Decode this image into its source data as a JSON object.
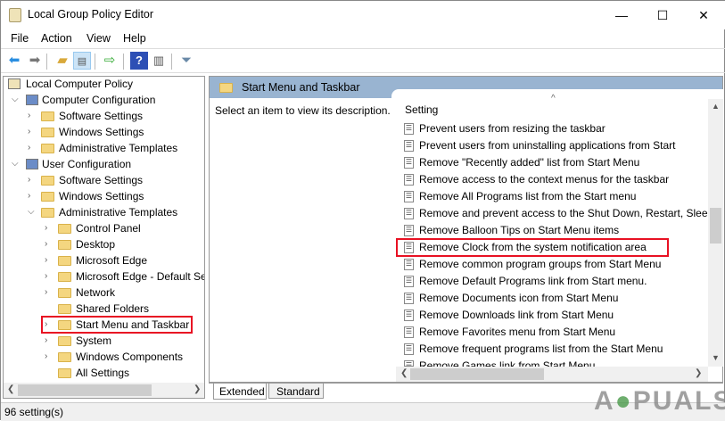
{
  "window": {
    "title": "Local Group Policy Editor",
    "minimize": "—",
    "maximize": "☐",
    "close": "✕"
  },
  "menu": [
    "File",
    "Action",
    "View",
    "Help"
  ],
  "toolbar": {
    "icons": [
      "back-icon",
      "forward-icon",
      "up-folder-icon",
      "show-hide-tree-icon",
      "export-list-icon",
      "help-icon",
      "show-action-pane-icon",
      "filter-icon"
    ]
  },
  "tree": [
    {
      "label": "Local Computer Policy",
      "level": 0
    },
    {
      "label": "Computer Configuration",
      "level": 1,
      "expanded": true
    },
    {
      "label": "Software Settings",
      "level": 2
    },
    {
      "label": "Windows Settings",
      "level": 2
    },
    {
      "label": "Administrative Templates",
      "level": 2
    },
    {
      "label": "User Configuration",
      "level": 1,
      "expanded": true
    },
    {
      "label": "Software Settings",
      "level": 2
    },
    {
      "label": "Windows Settings",
      "level": 2
    },
    {
      "label": "Administrative Templates",
      "level": 2,
      "expanded": true
    },
    {
      "label": "Control Panel",
      "level": 3
    },
    {
      "label": "Desktop",
      "level": 3
    },
    {
      "label": "Microsoft Edge",
      "level": 3
    },
    {
      "label": "Microsoft Edge - Default Se",
      "level": 3
    },
    {
      "label": "Network",
      "level": 3
    },
    {
      "label": "Shared Folders",
      "level": 3,
      "nochev": true
    },
    {
      "label": "Start Menu and Taskbar",
      "level": 3,
      "selected": true
    },
    {
      "label": "System",
      "level": 3
    },
    {
      "label": "Windows Components",
      "level": 3
    },
    {
      "label": "All Settings",
      "level": 3,
      "nochev": true
    }
  ],
  "right": {
    "header": "Start Menu and Taskbar",
    "description": "Select an item to view its description.",
    "column": "Setting",
    "settings": [
      "Prevent users from resizing the taskbar",
      "Prevent users from uninstalling applications from Start",
      "Remove \"Recently added\" list from Start Menu",
      "Remove access to the context menus for the taskbar",
      "Remove All Programs list from the Start menu",
      "Remove and prevent access to the Shut Down, Restart, Sleep...",
      "Remove Balloon Tips on Start Menu items",
      "Remove Clock from the system notification area",
      "Remove common program groups from Start Menu",
      "Remove Default Programs link from Start menu.",
      "Remove Documents icon from Start Menu",
      "Remove Downloads link from Start Menu",
      "Remove Favorites menu from Start Menu",
      "Remove frequent programs list from the Start Menu",
      "Remove Games link from Start Menu"
    ],
    "highlighted_index": 7
  },
  "tabs": [
    "Extended",
    "Standard"
  ],
  "status": "96 setting(s)",
  "watermark": "APPUALS",
  "colors": {
    "highlight": "#e81123",
    "header": "#99b4d1"
  }
}
